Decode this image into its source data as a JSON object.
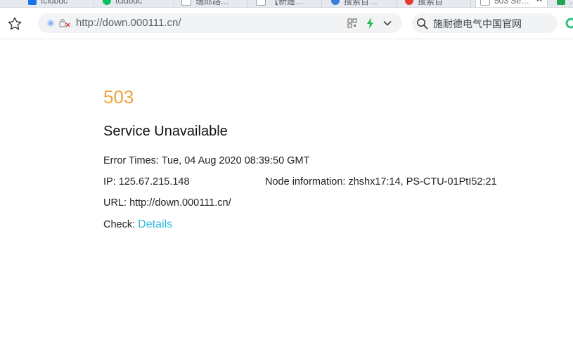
{
  "tabs": [
    {
      "label": "tcidbdc",
      "icon": "bar-chart-favicon-icon",
      "color": "#1a73e8",
      "active": false
    },
    {
      "label": "tcidbdc",
      "icon": "wechat-favicon-icon",
      "color": "#07c160",
      "active": false
    },
    {
      "label": "瑞郎路…",
      "icon": "page-favicon-icon",
      "color": "#9aa0a6",
      "active": false
    },
    {
      "label": "【新建…",
      "icon": "page-favicon-icon",
      "color": "#9aa0a6",
      "active": false
    },
    {
      "label": "搜索百…",
      "icon": "paw-favicon-icon",
      "color": "#3b7ddd",
      "active": false
    },
    {
      "label": "搜索百",
      "icon": "red-circle-favicon-icon",
      "color": "#e53935",
      "active": false
    },
    {
      "label": "503 Se…",
      "icon": "page-favicon-icon",
      "color": "#9aa0a6",
      "active": true,
      "close": "✕"
    },
    {
      "label": "…",
      "icon": "green-favicon-icon",
      "color": "#22a652",
      "active": false
    }
  ],
  "toolbar": {
    "url": "http://down.000111.cn/",
    "search_text": "施耐德电气中国官网"
  },
  "page": {
    "code": "503",
    "title": "Service Unavailable",
    "error_times": "Error Times: Tue, 04 Aug 2020 08:39:50 GMT",
    "ip": "IP: 125.67.215.148",
    "node_info": "Node information: zhshx17:14, PS-CTU-01PtI52:21",
    "url_line": "URL: http://down.000111.cn/",
    "check_label": "Check: ",
    "details_link": "Details"
  },
  "colors": {
    "code": "#f0a23c",
    "link": "#29b9e0",
    "bolt": "#1db954"
  }
}
